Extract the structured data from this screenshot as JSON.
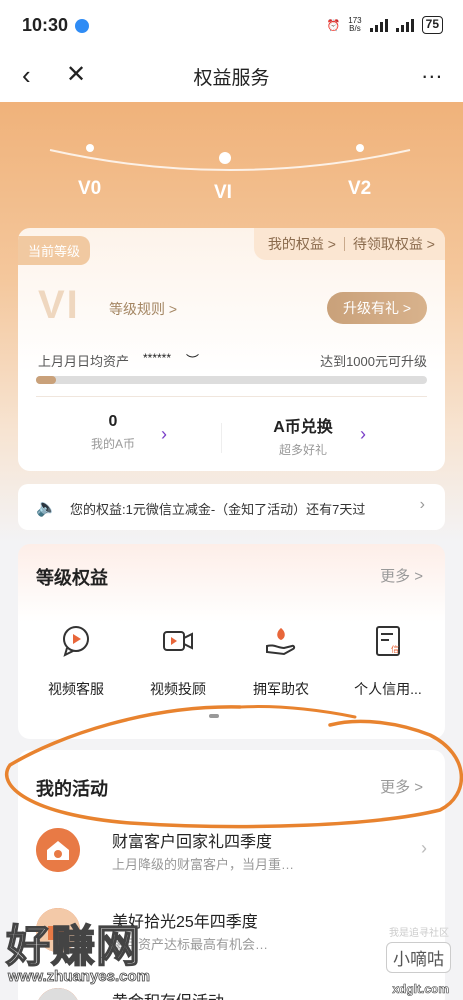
{
  "status_bar": {
    "time": "10:30",
    "net_speed_value": "173",
    "net_speed_unit": "B/s",
    "battery": "75"
  },
  "nav": {
    "title": "权益服务",
    "more": "..."
  },
  "levels": {
    "labels": [
      "V0",
      "VI",
      "V2"
    ],
    "current": "VI"
  },
  "card": {
    "current_level_tag": "当前等级",
    "my_rights": "我的权益 >",
    "pending_rights": "待领取权益 >",
    "level_big": "VI",
    "level_rules": "等级规则 >",
    "upgrade_button": "升级有礼 >",
    "asset_label": "上月月日均资产",
    "asset_masked": "******",
    "upgrade_hint": "达到1000元可升级",
    "progress_fraction": 0.05,
    "coins_value": "0",
    "coins_label": "我的A币",
    "exchange_title": "A币兑换",
    "exchange_sub": "超多好礼"
  },
  "notice": {
    "text": "您的权益:1元微信立减金-（金知了活动）还有7天过"
  },
  "benefits": {
    "title": "等级权益",
    "more": "更多 >",
    "items": [
      {
        "label": "视频客服"
      },
      {
        "label": "视频投顾"
      },
      {
        "label": "拥军助农"
      },
      {
        "label": "个人信用..."
      }
    ]
  },
  "activities": {
    "title": "我的活动",
    "more": "更多 >",
    "items": [
      {
        "name": "财富客户回家礼四季度",
        "desc": "上月降级的财富客户，当月重…"
      },
      {
        "name": "美好拾光25年四季度",
        "desc": "每月资产达标最高有机会…"
      },
      {
        "name": "黄金积存促活动",
        "desc": ""
      }
    ]
  },
  "watermark": {
    "brand": "好赚网",
    "url": "www.zhuanyes.com",
    "badge": "小嘀咕",
    "badge_top": "我是追寻社区",
    "site": "xdglt.com"
  },
  "colors": {
    "accent": "#c9a17a",
    "hero_top": "#f0b27a",
    "annotation": "#e8832f",
    "activity_icon": "#e87a45"
  }
}
